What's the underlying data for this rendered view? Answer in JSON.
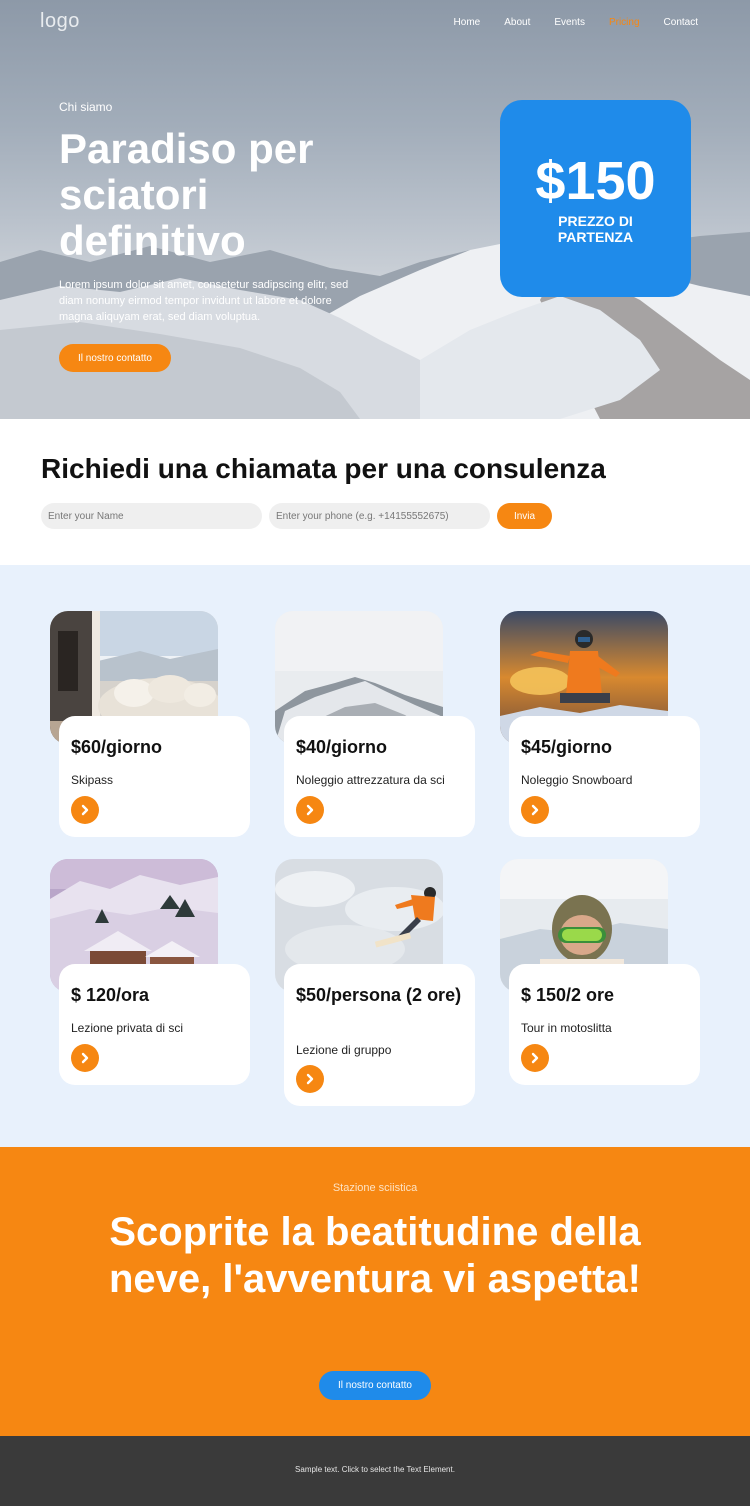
{
  "header": {
    "logo": "logo",
    "nav": [
      "Home",
      "About",
      "Events",
      "Pricing",
      "Contact"
    ]
  },
  "hero": {
    "eyebrow": "Chi siamo",
    "title": "Paradiso per sciatori definitivo",
    "text": "Lorem ipsum dolor sit amet, consetetur sadipscing elitr, sed diam nonumy eirmod tempor invidunt ut labore et dolore magna aliquyam erat, sed diam voluptua.",
    "button": "Il nostro contatto",
    "price": "$150",
    "price_label": "PREZZO DI PARTENZA"
  },
  "consult": {
    "title": "Richiedi una chiamata per una consulenza",
    "name_placeholder": "Enter your Name",
    "phone_placeholder": "Enter your phone (e.g. +14155552675)",
    "submit": "Invia"
  },
  "offers": [
    {
      "price": "$60/giorno",
      "label": "Skipass"
    },
    {
      "price": "$40/giorno",
      "label": "Noleggio attrezzatura da sci"
    },
    {
      "price": "$45/giorno",
      "label": "Noleggio Snowboard"
    },
    {
      "price": "$ 120/ora",
      "label": "Lezione privata di sci"
    },
    {
      "price": "$50/persona (2 ore)",
      "label": "Lezione di gruppo"
    },
    {
      "price": "$ 150/2 ore",
      "label": "Tour in motoslitta"
    }
  ],
  "promo": {
    "eyebrow": "Stazione sciistica",
    "title": "Scoprite la beatitudine della neve, l'avventura vi aspetta!",
    "button": "Il nostro contatto"
  },
  "footer": {
    "text": "Sample text. Click to select the Text Element."
  },
  "colors": {
    "accent": "#f68712",
    "blue": "#1f8bea",
    "light_bg": "#e8f1fc",
    "footer_bg": "#3a3a3a"
  }
}
